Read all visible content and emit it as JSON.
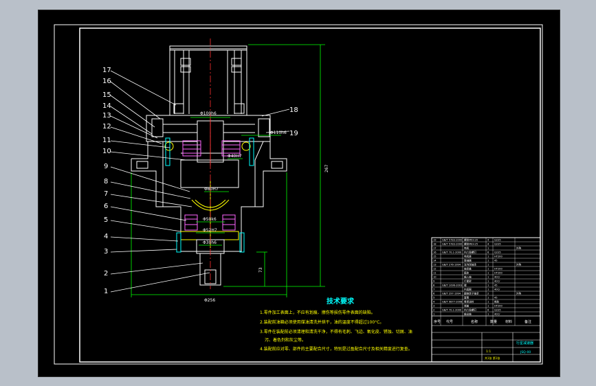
{
  "drawing": {
    "callouts_left": [
      "17",
      "16",
      "15",
      "14",
      "13",
      "12",
      "11",
      "10",
      "9",
      "8",
      "7",
      "6",
      "5",
      "4",
      "3",
      "2",
      "1"
    ],
    "callouts_right": [
      "18",
      "19"
    ],
    "dims": {
      "motor_flange": "Φ100h6",
      "right_fit": "Φ110h6",
      "bore_fit": "Φ40H7",
      "inner_fit": "Φ80H7",
      "bearing_fit": "Φ50k6",
      "shaft_fit": "Φ52H7",
      "shaft_end": "Φ30h6",
      "height_total": "267",
      "height_lower": "73",
      "base_width": "Φ256"
    }
  },
  "tech": {
    "title": "技术要求",
    "lines": [
      "1.零件加工表面上，不应有划痕、擦伤等损伤零件表面的缺陷。",
      "2.装配前油箱必须使用煤油清洗并烘干，油的温度不得超过100°C。",
      "3.零件在装配前必须清理和清洗干净，不得有毛刺、飞边、氧化皮、锈蚀、切屑、油",
      "污、着色剂和灰尘等。",
      "4.装配前应对零、部件的主要配合尺寸，特别是过盈配合尺寸及相关精度进行复查。"
    ]
  },
  "titleblock": {
    "rows": [
      {
        "no": "19",
        "code": "GB/T 5783-2000",
        "name": "螺栓M6×20",
        "qty": "4",
        "mat": "Q235",
        "note": ""
      },
      {
        "no": "18",
        "code": "GB/T 5783-2000",
        "name": "螺栓M8×25",
        "qty": "4",
        "mat": "Q235",
        "note": ""
      },
      {
        "no": "17",
        "code": "",
        "name": "电机",
        "qty": "1",
        "mat": "",
        "note": "外购"
      },
      {
        "no": "16",
        "code": "GB/T 70.1-2000",
        "name": "内六角螺钉",
        "qty": "6",
        "mat": "Q235",
        "note": ""
      },
      {
        "no": "15",
        "code": "",
        "name": "电机座",
        "qty": "1",
        "mat": "HT200",
        "note": ""
      },
      {
        "no": "14",
        "code": "",
        "name": "联轴器",
        "qty": "1",
        "mat": "45",
        "note": ""
      },
      {
        "no": "13",
        "code": "GB/T 276-1994",
        "name": "深沟球轴承",
        "qty": "1",
        "mat": "",
        "note": "外购"
      },
      {
        "no": "12",
        "code": "",
        "name": "轴承盖",
        "qty": "1",
        "mat": "HT200",
        "note": ""
      },
      {
        "no": "11",
        "code": "",
        "name": "箱体",
        "qty": "1",
        "mat": "HT200",
        "note": ""
      },
      {
        "no": "10",
        "code": "",
        "name": "输入轴",
        "qty": "1",
        "mat": "40Cr",
        "note": ""
      },
      {
        "no": "9",
        "code": "",
        "name": "行星架",
        "qty": "1",
        "mat": "40Cr",
        "note": ""
      },
      {
        "no": "8",
        "code": "GB/T 1096-2003",
        "name": "键",
        "qty": "1",
        "mat": "45",
        "note": ""
      },
      {
        "no": "7",
        "code": "",
        "name": "内齿圈",
        "qty": "1",
        "mat": "40Cr",
        "note": ""
      },
      {
        "no": "6",
        "code": "GB/T 297-1994",
        "name": "圆锥滚子轴承",
        "qty": "2",
        "mat": "",
        "note": "外购"
      },
      {
        "no": "5",
        "code": "",
        "name": "套筒",
        "qty": "1",
        "mat": "45",
        "note": ""
      },
      {
        "no": "4",
        "code": "GB/T 9877-2008",
        "name": "骨架油封",
        "qty": "1",
        "mat": "橡胶",
        "note": ""
      },
      {
        "no": "3",
        "code": "",
        "name": "端盖",
        "qty": "1",
        "mat": "HT200",
        "note": ""
      },
      {
        "no": "2",
        "code": "GB/T 70.1-2000",
        "name": "内六角螺钉",
        "qty": "6",
        "mat": "Q235",
        "note": ""
      },
      {
        "no": "1",
        "code": "",
        "name": "输出轴",
        "qty": "1",
        "mat": "40Cr",
        "note": ""
      }
    ],
    "header": [
      "序号",
      "代号",
      "名称",
      "数量",
      "材料",
      "备注"
    ],
    "title": "行星减速器",
    "drawing_no": "JSQ-00",
    "scale": "1:1",
    "sheet": "共1张 第1张"
  }
}
